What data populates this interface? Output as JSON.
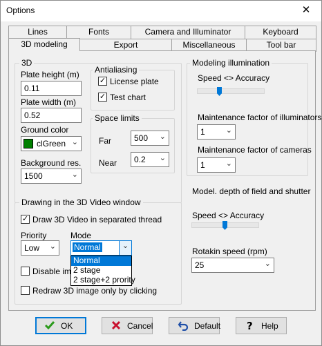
{
  "window": {
    "title": "Options",
    "close_glyph": "✕"
  },
  "tabs_row1": [
    "Lines",
    "Fonts",
    "Camera and Illuminator",
    "Keyboard"
  ],
  "tabs_row2": [
    "3D modeling",
    "Export",
    "Miscellaneous",
    "Tool bar"
  ],
  "active_tab": "3D modeling",
  "group_3d": {
    "label": "3D",
    "plate_height_label": "Plate height (m)",
    "plate_height_value": "0.11",
    "plate_width_label": "Plate width (m)",
    "plate_width_value": "0.52",
    "ground_color_label": "Ground color",
    "ground_color_value": "clGreen",
    "ground_color_hex": "#008000",
    "background_res_label": "Background res.",
    "background_res_value": "1500"
  },
  "antialiasing": {
    "label": "Antialiasing",
    "license_plate_label": "License plate",
    "license_plate_checked": true,
    "test_chart_label": "Test chart",
    "test_chart_checked": true
  },
  "space_limits": {
    "label": "Space limits",
    "far_label": "Far",
    "far_value": "500",
    "near_label": "Near",
    "near_value": "0.2"
  },
  "modeling_illumination": {
    "label": "Modeling illumination",
    "speed_label": "Speed <> Accuracy",
    "speed_level": 0.35,
    "illuminators_label": "Maintenance factor of illuminators",
    "illuminators_value": "1",
    "cameras_label": "Maintenance factor of cameras",
    "cameras_value": "1"
  },
  "depth_of_field": {
    "label": "Model. depth of field and shutter",
    "speed_label": "Speed <> Accuracy",
    "speed_level": 0.45,
    "rotakin_label": "Rotakin speed (rpm)",
    "rotakin_value": "25"
  },
  "drawing": {
    "label": "Drawing in the 3D Video window",
    "separated_thread_label": "Draw 3D Video in separated thread",
    "separated_thread_checked": true,
    "priority_label": "Priority",
    "priority_value": "Low",
    "mode_label": "Mode",
    "mode_value": "Normal",
    "mode_options": [
      "Normal",
      "2 stage",
      "2 stage+2 prority"
    ],
    "disable_label": "Disable imag",
    "disable_checked": false,
    "redraw_label": "Redraw 3D image only by clicking",
    "redraw_checked": false
  },
  "buttons": {
    "ok": "OK",
    "cancel": "Cancel",
    "default": "Default",
    "help": "Help"
  },
  "colors": {
    "accent": "#0078d7",
    "ok_check": "#2a9a1a",
    "cancel_x": "#c8102e"
  }
}
